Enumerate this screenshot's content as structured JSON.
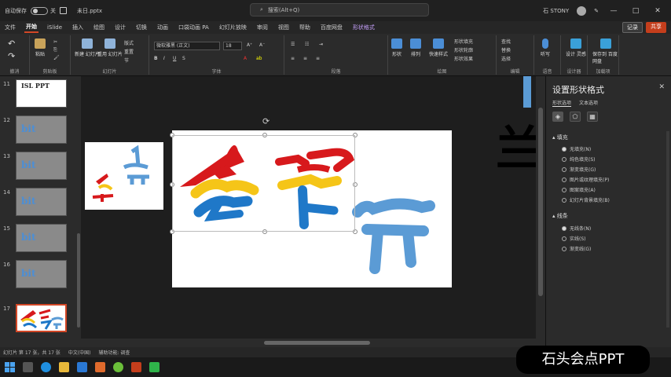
{
  "titlebar": {
    "autosave_label": "自动保存",
    "autosave_state": "关",
    "filename": "未日.pptx",
    "search_placeholder": "搜索(Alt+Q)",
    "user": "石 STONY",
    "minimize": "—",
    "maximize": "□",
    "close": "✕"
  },
  "tabs": [
    "文件",
    "开始",
    "iSlide",
    "插入",
    "绘图",
    "设计",
    "切换",
    "动画",
    "口袋动画 PA",
    "幻灯片放映",
    "审阅",
    "视图",
    "帮助",
    "百度网盘",
    "形状格式"
  ],
  "tab_actions": {
    "record": "记录",
    "share": "共享"
  },
  "ribbon": {
    "groups": [
      "剪贴板",
      "幻灯片",
      "字体",
      "段落",
      "绘图",
      "编辑",
      "语音",
      "设计器",
      "加载项"
    ],
    "undo": "撤消",
    "paste": "粘贴",
    "new_slide": "新建\n幻灯片",
    "reuse_slide": "重用\n幻灯片",
    "layout": "版式",
    "reset": "重置",
    "section": "节",
    "font_name": "微软雅黑 (正文)",
    "font_size": "18",
    "shapes": "形状",
    "arrange": "排列",
    "quick_styles": "快速样式",
    "shape_fill": "形状填充",
    "shape_outline": "形状轮廓",
    "shape_effects": "形状效果",
    "find": "查找",
    "replace": "替换",
    "select": "选择",
    "dictate": "听写",
    "designer": "设计\n灵感",
    "addins": "保存到\n百度网盘"
  },
  "thumbnails": [
    {
      "num": "11",
      "text": "ISL\nPPT",
      "style": "white"
    },
    {
      "num": "12",
      "text": "bit",
      "style": "gray"
    },
    {
      "num": "13",
      "text": "bit",
      "style": "gray"
    },
    {
      "num": "14",
      "text": "bit",
      "style": "gray"
    },
    {
      "num": "15",
      "text": "bit",
      "style": "gray"
    },
    {
      "num": "16",
      "text": "bit",
      "style": "gray"
    },
    {
      "num": "17",
      "text": "",
      "style": "selected"
    }
  ],
  "pane": {
    "title": "设置形状格式",
    "close": "✕",
    "subtabs": [
      "形状选项",
      "文本选项"
    ],
    "fill_section": "填充",
    "fill_options": [
      "无填充(N)",
      "纯色填充(S)",
      "渐变填充(G)",
      "图片或纹理填充(P)",
      "图案填充(A)",
      "幻灯片背景填充(B)"
    ],
    "line_section": "线条",
    "line_options": [
      "无线条(N)",
      "实线(S)",
      "渐变线(G)"
    ]
  },
  "statusbar": {
    "slide_info": "幻灯片 第 17 张，共 17 张",
    "language": "中文(中国)",
    "accessibility": "辅助功能: 调查"
  },
  "watermark": "石头会点PPT",
  "colors": {
    "accent": "#d24726",
    "red": "#d7191c",
    "yellow": "#f5c518",
    "blue": "#1f78c8",
    "lightblue": "#5b9bd5"
  }
}
